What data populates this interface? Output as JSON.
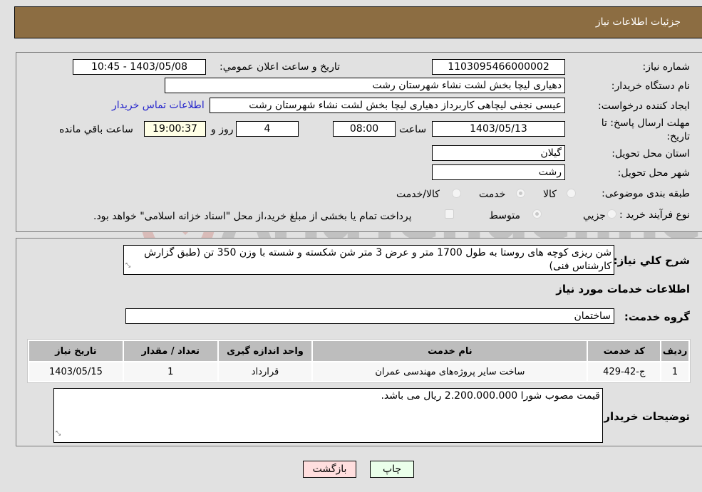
{
  "header": {
    "title": "جزئیات اطلاعات نیاز"
  },
  "form": {
    "need_number": {
      "label": "شماره نیاز:",
      "value": "1103095466000002"
    },
    "announce_datetime": {
      "label": "تاريخ و ساعت اعلان عمومي:",
      "value": "1403/05/08 - 10:45"
    },
    "buyer_org": {
      "label": "نام دستگاه خريدار:",
      "value": "دهیاری لیچا بخش لشت نشاء شهرستان رشت"
    },
    "requester": {
      "label": "ایجاد کننده درخواست:",
      "value": "عیسی نجفی لیچاهی کاربرداز دهیاری لیچا بخش لشت نشاء شهرستان رشت"
    },
    "buyer_contact_link": "اطلاعات تماس خريدار",
    "deadline": {
      "label": "مهلت ارسال پاسخ: تا تاریخ:",
      "date": "1403/05/13",
      "time_label": "ساعت",
      "time": "08:00",
      "days": "4",
      "days_label": "روز و",
      "remaining": "19:00:37",
      "remaining_label": "ساعت باقي مانده"
    },
    "province": {
      "label": "استان محل تحویل:",
      "value": "گیلان"
    },
    "city": {
      "label": "شهر محل تحویل:",
      "value": "رشت"
    },
    "category": {
      "label": "طبقه بندی موضوعی:",
      "options": [
        "کالا",
        "خدمت",
        "کالا/خدمت"
      ],
      "selected": "خدمت"
    },
    "purchase_type": {
      "label": "نوع فرآیند خرید :",
      "options": [
        "جزيي",
        "متوسط"
      ],
      "selected": "متوسط",
      "treasury_checkbox_label": "پرداخت تمام یا بخشی از مبلغ خرید،از محل \"اسناد خزانه اسلامی\" خواهد بود.",
      "treasury_checked": false
    }
  },
  "description": {
    "label": "شرح کلي نياز:",
    "value": "شن ریزی کوچه های روستا به طول 1700 متر و عرض 3 متر شن شکسته و شسته با وزن 350 تن (طبق گزارش کارشناس فنی)"
  },
  "services": {
    "section_title": "اطلاعات خدمات مورد نياز",
    "group_label": "گروه خدمت:",
    "group_value": "ساختمان",
    "table": {
      "headers": [
        "رديف",
        "کد خدمت",
        "نام خدمت",
        "واحد اندازه گيری",
        "تعداد / مقدار",
        "تاريخ نياز"
      ],
      "rows": [
        [
          "1",
          "ج-42-429",
          "ساخت سایر پروژه‌های مهندسی عمران",
          "قرارداد",
          "1",
          "1403/05/15"
        ]
      ]
    }
  },
  "buyer_notes": {
    "label": "توضيحات خريدار:",
    "value": "قیمت مصوب شورا 2.200.000.000 ریال می باشد."
  },
  "buttons": {
    "print": "چاپ",
    "back": "بازگشت"
  },
  "watermark": {
    "text": "AriaTender.neT"
  },
  "colors": {
    "header_bg": "#8c6d42",
    "print_bg": "#eaffea",
    "back_bg": "#ffdede",
    "link": "#2222cc"
  }
}
